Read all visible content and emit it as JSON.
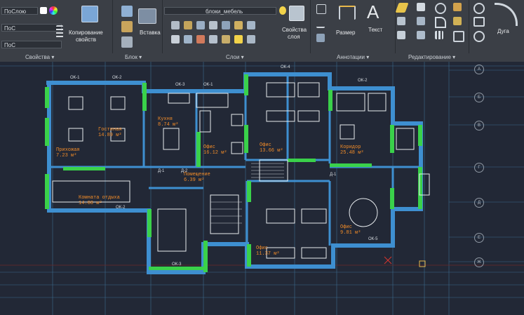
{
  "ribbon": {
    "properties": {
      "by_layer_1": "ПоСлою",
      "by_layer_2": "ПоС",
      "by_layer_3": "ПоС",
      "match_label_1": "Копирование",
      "match_label_2": "свойств",
      "panel_label": "Свойства"
    },
    "block": {
      "insert_label": "Вставка",
      "panel_label": "Блок"
    },
    "layers": {
      "current_layer": "блоки_мебель",
      "layer_props_1": "Свойства",
      "layer_props_2": "слоя",
      "panel_label": "Слои"
    },
    "annotation": {
      "dimension_label": "Размер",
      "text_label": "Текст",
      "panel_label": "Аннотации"
    },
    "modify": {
      "panel_label": "Редактирование"
    },
    "draw": {
      "arc_label": "Дуга"
    }
  },
  "drawing": {
    "rooms": [
      {
        "name": "Кухня",
        "area": "8.74 м²"
      },
      {
        "name": "Гостиная",
        "area": "14.89 м²"
      },
      {
        "name": "Прихожая",
        "area": "7.23 м²"
      },
      {
        "name": "Офис",
        "area": "16.12 м²"
      },
      {
        "name": "Офис",
        "area": "13.66 м²"
      },
      {
        "name": "Коридор",
        "area": "25.48 м²"
      },
      {
        "name": "Помещение",
        "area": "6.39 м²"
      },
      {
        "name": "Комната отдыха",
        "area": "14.08 м²"
      },
      {
        "name": "Офис",
        "area": "9.81 м²"
      },
      {
        "name": "Офис",
        "area": "11.37 м²"
      }
    ],
    "tags": [
      "ОК-1",
      "ОК-2",
      "ОК-3",
      "ОК-4",
      "ОК-1",
      "ОК-2",
      "Д-1",
      "Д-2",
      "Д-1",
      "ОК-2",
      "ОК-3",
      "ОК-5"
    ],
    "axes": [
      "А",
      "Б",
      "В",
      "Г",
      "Д",
      "Е",
      "Ж"
    ]
  },
  "colors": {
    "wall": "#3ad14a",
    "annotation": "#f28c28",
    "background": "#222836",
    "ribbon": "#3b3f46"
  }
}
